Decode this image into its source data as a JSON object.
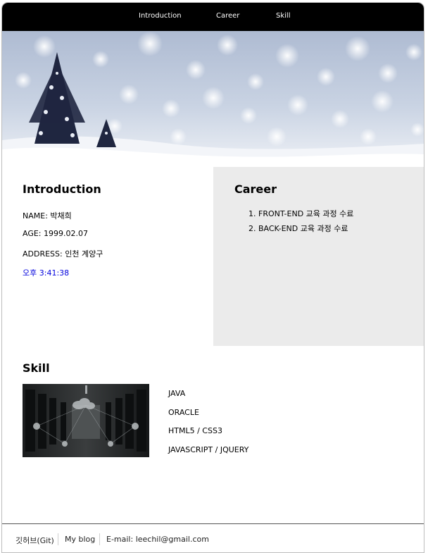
{
  "nav": {
    "items": [
      {
        "label": "Introduction"
      },
      {
        "label": "Career"
      },
      {
        "label": "Skill"
      }
    ]
  },
  "introduction": {
    "title": "Introduction",
    "name": "NAME: 박채희",
    "age": "AGE: 1999.02.07",
    "address": "ADDRESS: 인천 계양구",
    "clock": "오후 3:41:38"
  },
  "career": {
    "title": "Career",
    "items": [
      "1. FRONT-END 교육 과정 수료",
      "2. BACK-END 교육 과정 수료"
    ]
  },
  "skill": {
    "title": "Skill",
    "items": [
      "JAVA",
      "ORACLE",
      "HTML5 / CSS3",
      "JAVASCRIPT / JQUERY"
    ]
  },
  "footer": {
    "links": [
      {
        "label": "깃허브(Git)"
      },
      {
        "label": "My blog"
      },
      {
        "label": "E-mail: leechil@gmail.com"
      }
    ]
  },
  "colors": {
    "nav_background": "#000000",
    "career_background": "#ebebeb",
    "clock_text": "#0000dd",
    "footer_border": "#555555"
  },
  "icons": {
    "hero": "snowy-winter-tree-image",
    "skill": "server-room-image"
  }
}
